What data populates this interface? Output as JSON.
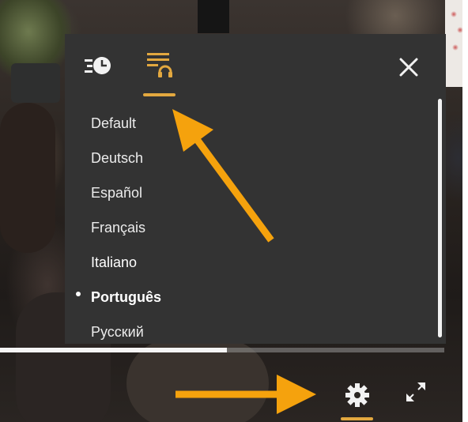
{
  "player": {
    "settings_panel": {
      "tabs": [
        {
          "name": "playback-speed",
          "icon": "speed-clock-icon",
          "selected": false
        },
        {
          "name": "audio-track",
          "icon": "audio-track-icon",
          "selected": true
        }
      ],
      "close_icon": "close-icon",
      "audio_languages": [
        {
          "label": "Default",
          "selected": false
        },
        {
          "label": "Deutsch",
          "selected": false
        },
        {
          "label": "Español",
          "selected": false
        },
        {
          "label": "Français",
          "selected": false
        },
        {
          "label": "Italiano",
          "selected": false
        },
        {
          "label": "Português",
          "selected": true
        },
        {
          "label": "Русский",
          "selected": false
        }
      ]
    },
    "progress": {
      "played_fraction": 0.51
    },
    "controls": {
      "settings_icon": "gear-icon",
      "fullscreen_icon": "fullscreen-icon"
    }
  },
  "colors": {
    "accent": "#e3a83f",
    "panel_bg": "#333333",
    "annotation_arrow": "#f5a20d"
  }
}
